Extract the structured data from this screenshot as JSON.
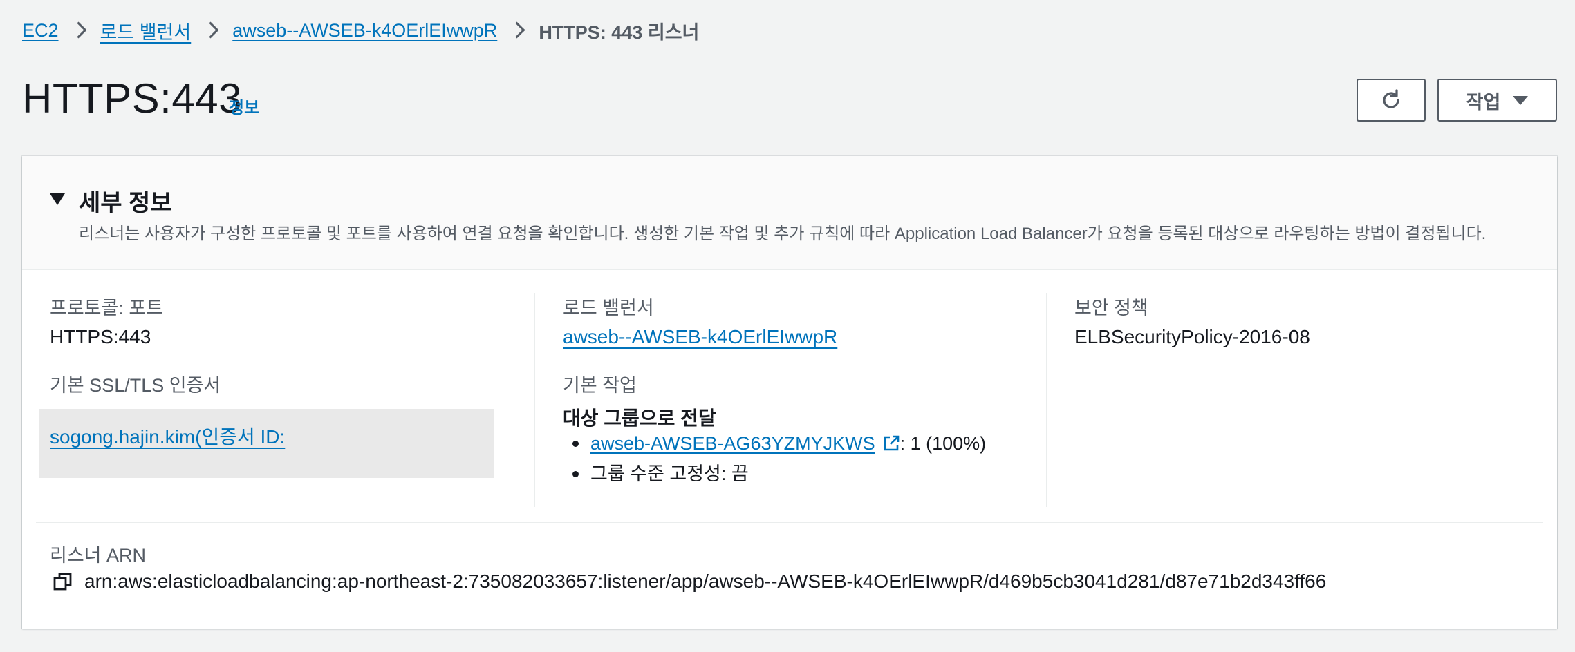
{
  "breadcrumb": {
    "ec2": "EC2",
    "load_balancers": "로드 밸런서",
    "lb_name": "awseb--AWSEB-k4OErlEIwwpR",
    "current": "HTTPS: 443 리스너"
  },
  "header": {
    "title": "HTTPS:443",
    "info": "정보",
    "actions_label": "작업"
  },
  "details": {
    "title": "세부 정보",
    "description": "리스너는 사용자가 구성한 프로토콜 및 포트를 사용하여 연결 요청을 확인합니다. 생성한 기본 작업 및 추가 규칙에 따라 Application Load Balancer가 요청을 등록된 대상으로 라우팅하는 방법이 결정됩니다.",
    "protocol_port_label": "프로토콜: 포트",
    "protocol_port_value": "HTTPS:443",
    "ssl_label": "기본 SSL/TLS 인증서",
    "ssl_value": "sogong.hajin.kim(인증서 ID: ",
    "lb_label": "로드 밸런서",
    "lb_value": "awseb--AWSEB-k4OErlEIwwpR",
    "default_action_label": "기본 작업",
    "default_action_title": "대상 그룹으로 전달",
    "target_group": "awseb-AWSEB-AG63YZMYJKWS",
    "target_weight": ": 1 (100%)",
    "stickiness": "그룹 수준 고정성: 끔",
    "security_policy_label": "보안 정책",
    "security_policy_value": "ELBSecurityPolicy-2016-08",
    "arn_label": "리스너 ARN",
    "arn_value": "arn:aws:elasticloadbalancing:ap-northeast-2:735082033657:listener/app/awseb--AWSEB-k4OErlEIwwpR/d469b5cb3041d281/d87e71b2d343ff66"
  },
  "icons": {
    "refresh": "refresh-icon",
    "caret": "caret-down-icon",
    "toggle": "expand-toggle-icon",
    "external": "external-link-icon",
    "copy": "copy-icon"
  },
  "colors": {
    "link": "#0073bb",
    "text": "#16191f",
    "muted": "#545b64",
    "background": "#f2f3f3"
  }
}
